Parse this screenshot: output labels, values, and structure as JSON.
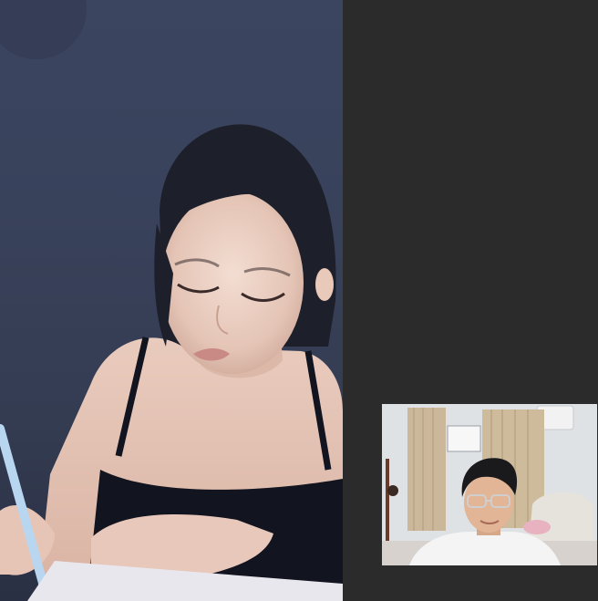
{
  "call": {
    "background_color": "#2b2b2c",
    "main_feed": {
      "participant": "remote-participant",
      "kind": "video-feed",
      "wall_color": "#3a435c"
    },
    "self_view": {
      "participant": "local-participant",
      "kind": "video-feed",
      "wall_color": "#e2e4e6",
      "curtain_color": "#c9b79a"
    }
  }
}
